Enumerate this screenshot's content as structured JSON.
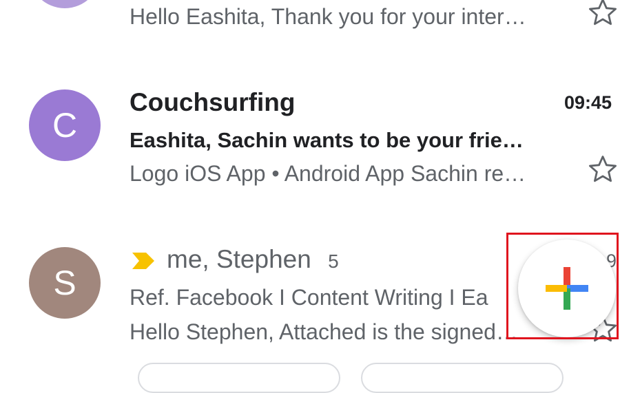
{
  "colors": {
    "avatar_c": "#9a7ad4",
    "avatar_s": "#a1877d",
    "important_marker": "#f7c200",
    "highlight_border": "#e0141e"
  },
  "messages": [
    {
      "snippet": "Hello Eashita, Thank you for your inter…",
      "star_icon": "star-outline-icon"
    },
    {
      "avatar_letter": "C",
      "sender": "Couchsurfing",
      "time": "09:45",
      "subject": "Eashita, Sachin wants to be your frie…",
      "snippet": "Logo iOS App • Android App Sachin re…",
      "star_icon": "star-outline-icon"
    },
    {
      "avatar_letter": "S",
      "marker_icon": "important-marker-icon",
      "sender": "me, Stephen",
      "count": "5",
      "time_partial": "9",
      "subject": "Ref. Facebook I Content Writing I Ea",
      "snippet": "Hello Stephen, Attached is the signed…",
      "star_icon": "star-outline-icon"
    }
  ],
  "compose_fab": {
    "icon": "compose-plus-icon"
  }
}
